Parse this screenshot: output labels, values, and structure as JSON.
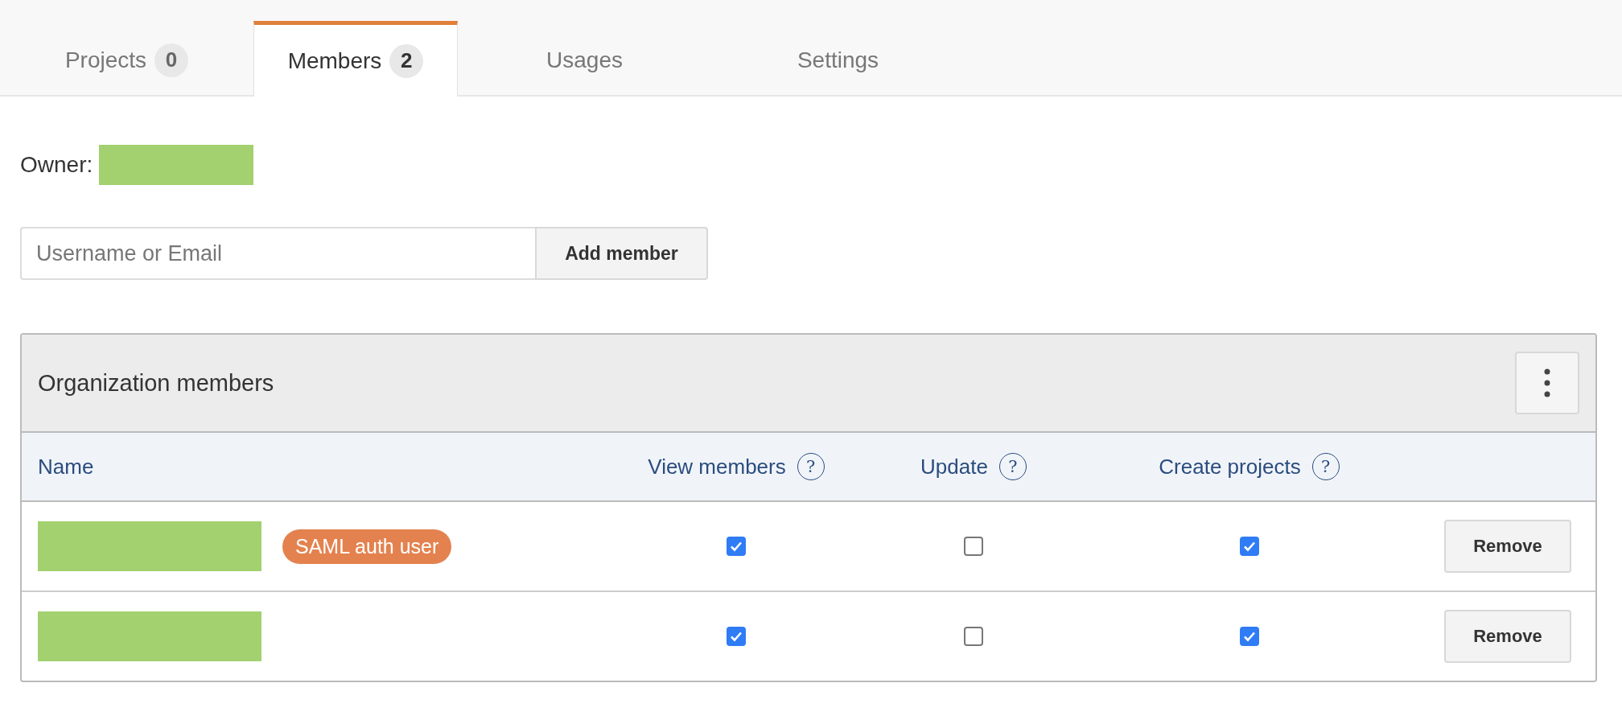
{
  "tabs": [
    {
      "label": "Projects",
      "count": "0",
      "selected": false
    },
    {
      "label": "Members",
      "count": "2",
      "selected": true
    },
    {
      "label": "Usages",
      "selected": false
    },
    {
      "label": "Settings",
      "selected": false
    }
  ],
  "owner": {
    "label": "Owner:"
  },
  "add_member": {
    "placeholder": "Username or Email",
    "button": "Add member"
  },
  "members_panel": {
    "title": "Organization members",
    "columns": [
      {
        "label": "Name"
      },
      {
        "label": "View members",
        "help": "?"
      },
      {
        "label": "Update",
        "help": "?"
      },
      {
        "label": "Create projects",
        "help": "?"
      }
    ],
    "rows": [
      {
        "badge": "SAML auth user",
        "view_members": true,
        "update": false,
        "create_projects": true,
        "action": "Remove"
      },
      {
        "view_members": true,
        "update": false,
        "create_projects": true,
        "action": "Remove"
      }
    ]
  }
}
